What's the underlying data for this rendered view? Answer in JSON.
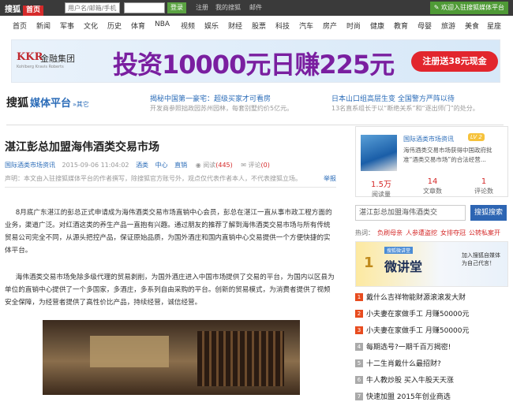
{
  "topbar": {
    "logo": "搜狐",
    "home": "首页",
    "user_placeholder": "用户名/邮箱/手机号",
    "login": "登录",
    "links": [
      "注册",
      "我的搜狐",
      "邮件"
    ],
    "welcome": "欢迎入驻搜狐媒体平台"
  },
  "nav": [
    "首页",
    "新闻",
    "军事",
    "文化",
    "历史",
    "体育",
    "NBA",
    "视频",
    "娱乐",
    "财经",
    "股票",
    "科技",
    "汽车",
    "房产",
    "时尚",
    "健康",
    "教育",
    "母婴",
    "旅游",
    "美食",
    "星座"
  ],
  "banner": {
    "brand": "KKR",
    "brand_cn": "金融集团",
    "brand_en": "Kohlberg Kravis Roberts",
    "headline": "投资10000元日赚225元",
    "button": "注册送38元现金"
  },
  "channel": {
    "sohu": "搜狐",
    "media": "媒体平台",
    "back": "»其它",
    "news1_title": "揭秘中国第一豪宅：超级买家才可看房",
    "news1_sub": "开发商参照拙政园苏州园林，每套别墅约价5亿元。",
    "news2_title": "日本山口组高层生变 全国警方严阵以待",
    "news2_sub": "13名直系组长于以“断绝关系”和“逐出师门”的处分。"
  },
  "article": {
    "title": "湛江彭总加盟海伟酒类交易市场",
    "source": "国际酒类市场资讯",
    "date": "2015-09-06 11:04:02",
    "tags": [
      "酒类",
      "中心",
      "直销"
    ],
    "reads_label": "阅读",
    "reads": "(445)",
    "comments_label": "评论",
    "comments": "(0)",
    "disclaimer": "声明：本文由入驻搜狐媒体平台的作者撰写，除搜狐官方账号外，观点仅代表作者本人，不代表搜狐立场。",
    "report": "举报",
    "p1": "8月底广东湛江的彭总正式申请成为海伟酒类交易市场直销中心会员，彭总在湛江一直从事市政工程方面的业务，渠道广泛。对红酒这类的养生产品一直抱有兴趣。通过朋友的推荐了解到海伟酒类交易市场与所有传统贸易公司完全不同，从源头把控产品，保证原始品质，为国外酒庄和国内直销中心交易提供一个方便快捷的实体平台。",
    "p2": "海伟酒类交易市场免除多级代理的贸易剥削，为国外酒庄进入中国市场提供了交易的平台，为国内以区县为单位的直销中心提供了一个多国家，多酒庄，多系列自由采购的平台。创新的贸易模式，为消费者提供了视频安全保障，为经营者提供了高性价比产品，持续经营，诚信经营。"
  },
  "sidebar": {
    "profile_name": "国际酒类市场资讯",
    "level": "LV 2",
    "profile_desc": "海伟酒类交易市场获得中国政府批准“酒类交易市场”的合法经营...",
    "stats": [
      {
        "n": "1.5万",
        "l": "阅读量"
      },
      {
        "n": "14",
        "l": "文章数"
      },
      {
        "n": "1",
        "l": "评论数"
      }
    ],
    "search_value": "湛江彭总加盟海伟酒类交",
    "search_button": "搜狐搜索",
    "hot_label": "热词：",
    "hot": [
      "负刷母亲",
      "人参遭盗挖",
      "女排夺冠",
      "公转私案开"
    ],
    "ad_num": "1",
    "ad_tag": "搜狐微讲堂",
    "ad_big": "微讲堂",
    "ad_right": "加入搜狐自媒体 为自己代言！",
    "list": [
      {
        "no": "1",
        "t": "戴什么吉祥物能财源滚滚发大财",
        "red": true
      },
      {
        "no": "2",
        "t": "小夫妻在家做手工 月赚50000元",
        "red": true
      },
      {
        "no": "3",
        "t": "小夫妻在家做手工 月赚50000元",
        "red": true
      },
      {
        "no": "4",
        "t": "每期选号?一期千百万揭密!",
        "red": false
      },
      {
        "no": "5",
        "t": "十二生肖戴什么最招财?",
        "red": false
      },
      {
        "no": "6",
        "t": "牛人教炒股 买入牛股天天涨",
        "red": false
      },
      {
        "no": "7",
        "t": "快速加盟 2015年创业商选",
        "red": false
      }
    ]
  }
}
